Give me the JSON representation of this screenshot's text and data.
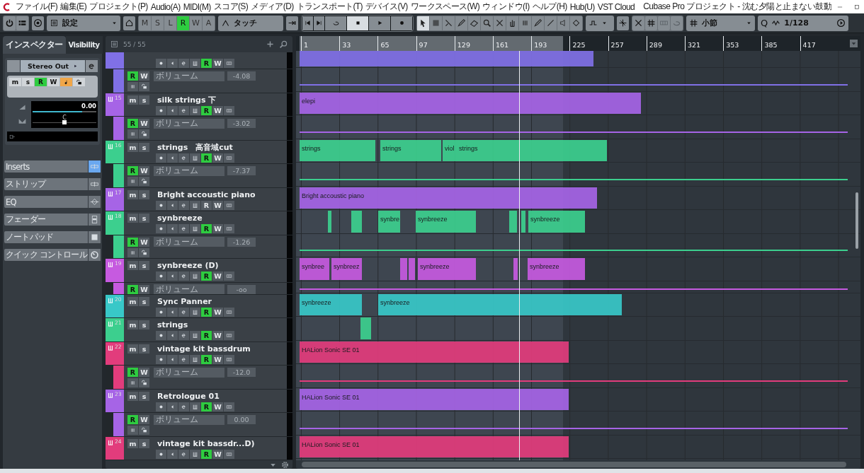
{
  "window": {
    "title": "Cubase Pro プロジェクト - 沈む夕陽と止まない鼓動",
    "menu": [
      "ファイル(F)",
      "編集(E)",
      "プロジェクト(P)",
      "Audio(A)",
      "MIDI(M)",
      "スコア(S)",
      "メディア(D)",
      "トランスポート(T)",
      "デバイス(V)",
      "ワークスペース(W)",
      "ウィンドウ(I)",
      "ヘルプ(H)",
      "Hub(U)",
      "VST Cloud"
    ]
  },
  "toolbar": {
    "preset": "設定",
    "automation_buttons": [
      {
        "label": "M",
        "on": false
      },
      {
        "label": "S",
        "on": false
      },
      {
        "label": "L",
        "on": false
      },
      {
        "label": "R",
        "on": true
      },
      {
        "label": "W",
        "on": false
      },
      {
        "label": "A",
        "on": false
      }
    ],
    "automation_mode": "タッチ",
    "grid_type": "小節",
    "quantize_label": "Q",
    "quantize": "1/128"
  },
  "inspector": {
    "tabs": [
      {
        "label": "インスペクター",
        "selected": true
      },
      {
        "label": "Visibility",
        "selected": false
      }
    ],
    "output": "Stereo Out",
    "buttons": [
      {
        "label": "m",
        "on": false
      },
      {
        "label": "s",
        "on": false
      },
      {
        "label": "R",
        "on": true
      },
      {
        "label": "W",
        "on": false
      }
    ],
    "monitor": {
      "on": true
    },
    "volume": {
      "reading": "0.00",
      "level": 0.78
    },
    "pan": {
      "reading": "C",
      "level": 0.5
    },
    "sections": [
      {
        "label": "Inserts",
        "on": true
      },
      {
        "label": "ストリップ",
        "on": false
      },
      {
        "label": "EQ",
        "on": false
      },
      {
        "label": "フェーダー",
        "on": false
      },
      {
        "label": "ノートパッド",
        "on": false
      },
      {
        "label": "クイック コントロール",
        "on": false
      }
    ]
  },
  "track_list": {
    "count": "55 / 55"
  },
  "ruler": {
    "marks": [
      "1",
      "33",
      "65",
      "97",
      "129",
      "161",
      "193",
      "225",
      "257",
      "289",
      "321",
      "353",
      "385",
      "417"
    ]
  },
  "tracks": [
    {
      "color": "#8070e6",
      "read": {
        "label": "R",
        "on": true
      },
      "write": "W",
      "automation": {
        "read": {
          "label": "R",
          "on": true
        },
        "write": "W",
        "parameter": "ボリューム",
        "value": "-4.08",
        "expanded": true
      }
    },
    {
      "number": "15",
      "name": "silk strings 下",
      "color": "#a664e6",
      "mute": "m",
      "solo": "s",
      "read": {
        "label": "R",
        "on": true
      },
      "write": "W",
      "automation": {
        "read": {
          "label": "R",
          "on": true
        },
        "write": "W",
        "parameter": "ボリューム",
        "value": "-3.02",
        "expanded": true
      },
      "events": [
        {
          "label": "elepi"
        }
      ]
    },
    {
      "number": "16",
      "name": "strings　高音域cut",
      "color": "#3ccf8e",
      "mute": "m",
      "solo": "s",
      "read": {
        "label": "R",
        "on": true
      },
      "write": "W",
      "automation": {
        "read": {
          "label": "R",
          "on": true
        },
        "write": "W",
        "parameter": "ボリューム",
        "value": "-7.37",
        "expanded": true
      },
      "events": [
        {
          "label": "strings"
        },
        {
          "label": "strings"
        },
        {
          "label": "viol"
        },
        {
          "label": "strings"
        }
      ]
    },
    {
      "number": "17",
      "name": "Bright accoustic piano",
      "color": "#a664e6",
      "mute": "m",
      "solo": "s",
      "read": {
        "label": "R",
        "on": false
      },
      "write": "W",
      "events": [
        {
          "label": "Bright accoustic piano"
        }
      ]
    },
    {
      "number": "18",
      "name": "synbreeze",
      "color": "#3ccf8e",
      "mute": "m",
      "solo": "s",
      "read": {
        "label": "R",
        "on": true
      },
      "write": "W",
      "automation": {
        "read": {
          "label": "R",
          "on": true
        },
        "write": "W",
        "parameter": "ボリューム",
        "value": "-1.26",
        "expanded": true
      },
      "events": [
        {
          "label": "synbre"
        },
        {
          "label": "synbreeze"
        },
        {
          "label": "synbreeze"
        }
      ]
    },
    {
      "number": "19",
      "name": "synbreeze (D)",
      "color": "#c65ae0",
      "mute": "m",
      "solo": "s",
      "read": {
        "label": "R",
        "on": true
      },
      "write": "W",
      "automation": {
        "read": {
          "label": "R",
          "on": true
        },
        "write": "W",
        "parameter": "ボリューム",
        "value": "-oo",
        "expanded": false
      },
      "events": [
        {
          "label": "synbree"
        },
        {
          "label": "synbreez"
        },
        {
          "label": "synbreeze"
        },
        {
          "label": "synbreeze"
        }
      ]
    },
    {
      "number": "20",
      "name": "Sync Panner",
      "color": "#38c8c8",
      "mute": "m",
      "solo": "s",
      "read": {
        "label": "R",
        "on": true
      },
      "write": "W",
      "events": [
        {
          "label": "synbreeze"
        },
        {
          "label": "synbreeze"
        }
      ]
    },
    {
      "number": "21",
      "name": "strings",
      "color": "#3ccf8e",
      "mute": "m",
      "solo": "s",
      "read": {
        "label": "R",
        "on": true
      },
      "write": "W"
    },
    {
      "number": "22",
      "name": "vintage kit bassdrum",
      "color": "#e23c7c",
      "mute": "m",
      "solo": "s",
      "read": {
        "label": "R",
        "on": true
      },
      "write": "W",
      "automation": {
        "read": {
          "label": "R",
          "on": true
        },
        "write": "W",
        "parameter": "ボリューム",
        "value": "-12.0",
        "expanded": true
      },
      "events": [
        {
          "label": "HALion Sonic SE 01"
        }
      ]
    },
    {
      "number": "23",
      "name": "Retrologue 01",
      "color": "#a664e6",
      "mute": "m",
      "solo": "s",
      "read": {
        "label": "R",
        "on": true
      },
      "write": "W",
      "automation": {
        "read": {
          "label": "R",
          "on": true
        },
        "write": "W",
        "parameter": "ボリューム",
        "value": "0.00",
        "expanded": true
      },
      "events": [
        {
          "label": "HALion Sonic SE 01"
        }
      ]
    },
    {
      "number": "24",
      "name": "vintage kit bassdr...D)",
      "color": "#e23c7c",
      "mute": "m",
      "solo": "s",
      "read": {
        "label": "R",
        "on": true
      },
      "write": "W",
      "events": [
        {
          "label": "HALion Sonic SE 01"
        }
      ]
    }
  ]
}
